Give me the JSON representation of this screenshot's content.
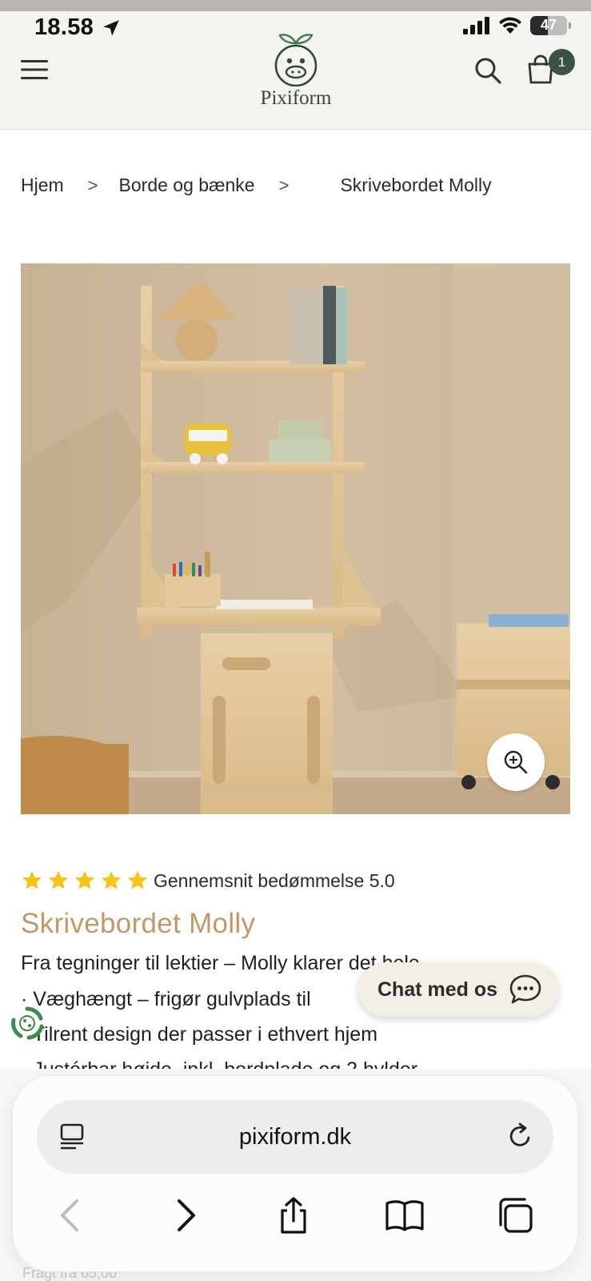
{
  "status_bar": {
    "time": "18.58",
    "battery": "47",
    "battery_level": 0.47
  },
  "header": {
    "logo_text": "Pixiform",
    "cart_count": "1"
  },
  "breadcrumb": {
    "items": [
      "Hjem",
      "Borde og bænke",
      "Skrivebordet Molly"
    ],
    "separator": ">"
  },
  "product": {
    "rating_text": "Gennemsnit bedømmelse 5.0",
    "rating_value": 5,
    "title": "Skrivebordet Molly",
    "description_lines": [
      "Fra tegninger til lektier – Molly klarer det hele",
      "· Væghængt – frigør gulvplads til",
      "· Tilrent design der passer i ethvert hjem",
      "· Justérbar højde, inkl. bordplade og 2 hylder"
    ],
    "shipping": "Fragt fra 65,00"
  },
  "chat": {
    "label": "Chat med os"
  },
  "browser": {
    "url": "pixiform.dk"
  },
  "colors": {
    "brand_green": "#3a5443",
    "title_gold": "#c2976a",
    "star": "#f6c21c",
    "header_bg": "#f5f3ef"
  },
  "icons": {
    "menu": "hamburger-icon",
    "search": "search-icon",
    "cart": "shopping-bag-icon",
    "zoom": "zoom-in-icon",
    "chat": "chat-bubble-icon",
    "reader": "reader-mode-icon",
    "reload": "reload-icon",
    "back": "back-arrow-icon",
    "forward": "forward-arrow-icon",
    "share": "share-icon",
    "bookmarks": "bookmarks-icon",
    "tabs": "tabs-icon"
  }
}
